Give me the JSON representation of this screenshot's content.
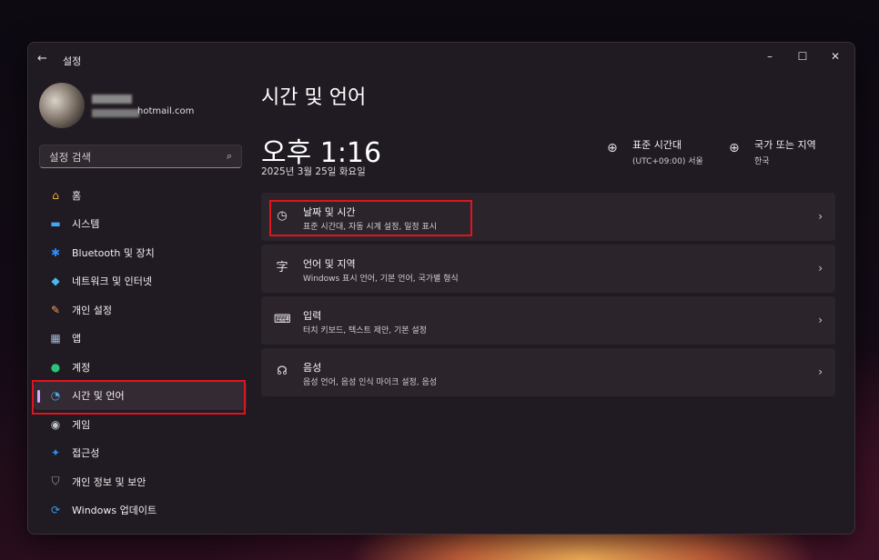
{
  "window": {
    "title": "설정",
    "back_icon": "←",
    "controls": {
      "minimize": "–",
      "maximize": "☐",
      "close": "✕"
    }
  },
  "profile": {
    "email_visible": "hotmail.com"
  },
  "search": {
    "placeholder": "설정 검색",
    "icon": "⌕"
  },
  "sidebar": {
    "items": [
      {
        "label": "홈",
        "icon": "home-icon",
        "glyph": "⌂",
        "color": "#f3b13c"
      },
      {
        "label": "시스템",
        "icon": "system-icon",
        "glyph": "▬",
        "color": "#3fa9f5"
      },
      {
        "label": "Bluetooth 및 장치",
        "icon": "bluetooth-icon",
        "glyph": "✱",
        "color": "#2c8cff"
      },
      {
        "label": "네트워크 및 인터넷",
        "icon": "wifi-icon",
        "glyph": "◆",
        "color": "#48b8f0"
      },
      {
        "label": "개인 설정",
        "icon": "brush-icon",
        "glyph": "✎",
        "color": "#f0a35a"
      },
      {
        "label": "앱",
        "icon": "apps-icon",
        "glyph": "▦",
        "color": "#9fb8d8"
      },
      {
        "label": "계정",
        "icon": "account-icon",
        "glyph": "●",
        "color": "#2dc27a"
      },
      {
        "label": "시간 및 언어",
        "icon": "time-language-icon",
        "glyph": "◔",
        "color": "#4aa8e8",
        "selected": true
      },
      {
        "label": "게임",
        "icon": "gaming-icon",
        "glyph": "◉",
        "color": "#bfc6d0"
      },
      {
        "label": "접근성",
        "icon": "accessibility-icon",
        "glyph": "✦",
        "color": "#2f8cf0"
      },
      {
        "label": "개인 정보 및 보안",
        "icon": "shield-icon",
        "glyph": "⛉",
        "color": "#9aa3ad"
      },
      {
        "label": "Windows 업데이트",
        "icon": "update-icon",
        "glyph": "⟳",
        "color": "#2f9cf0"
      }
    ]
  },
  "main": {
    "page_title": "시간 및 언어",
    "clock": "오후 1:16",
    "date": "2025년 3월 25일 화요일",
    "timezone": {
      "title": "표준 시간대",
      "value": "(UTC+09:00) 서울",
      "icon": "globe-clock-icon"
    },
    "region": {
      "title": "국가 또는 지역",
      "value": "한국",
      "icon": "globe-icon"
    },
    "cards": [
      {
        "title": "날짜 및 시간",
        "subtitle": "표준 시간대, 자동 시계 설정, 일정 표시",
        "icon": "calendar-clock-icon",
        "glyph": "◷"
      },
      {
        "title": "언어 및 지역",
        "subtitle": "Windows 표시 언어, 기본 언어, 국가별 형식",
        "icon": "language-icon",
        "glyph": "字"
      },
      {
        "title": "입력",
        "subtitle": "터치 키보드, 텍스트 제안, 기본 설정",
        "icon": "keyboard-icon",
        "glyph": "⌨"
      },
      {
        "title": "음성",
        "subtitle": "음성 언어, 음성 인식 마이크 설정, 음성",
        "icon": "speech-icon",
        "glyph": "☊"
      }
    ],
    "chevron": "›"
  },
  "colors": {
    "highlight": "#e0141e",
    "selected_indicator": "#d7a7ff"
  }
}
